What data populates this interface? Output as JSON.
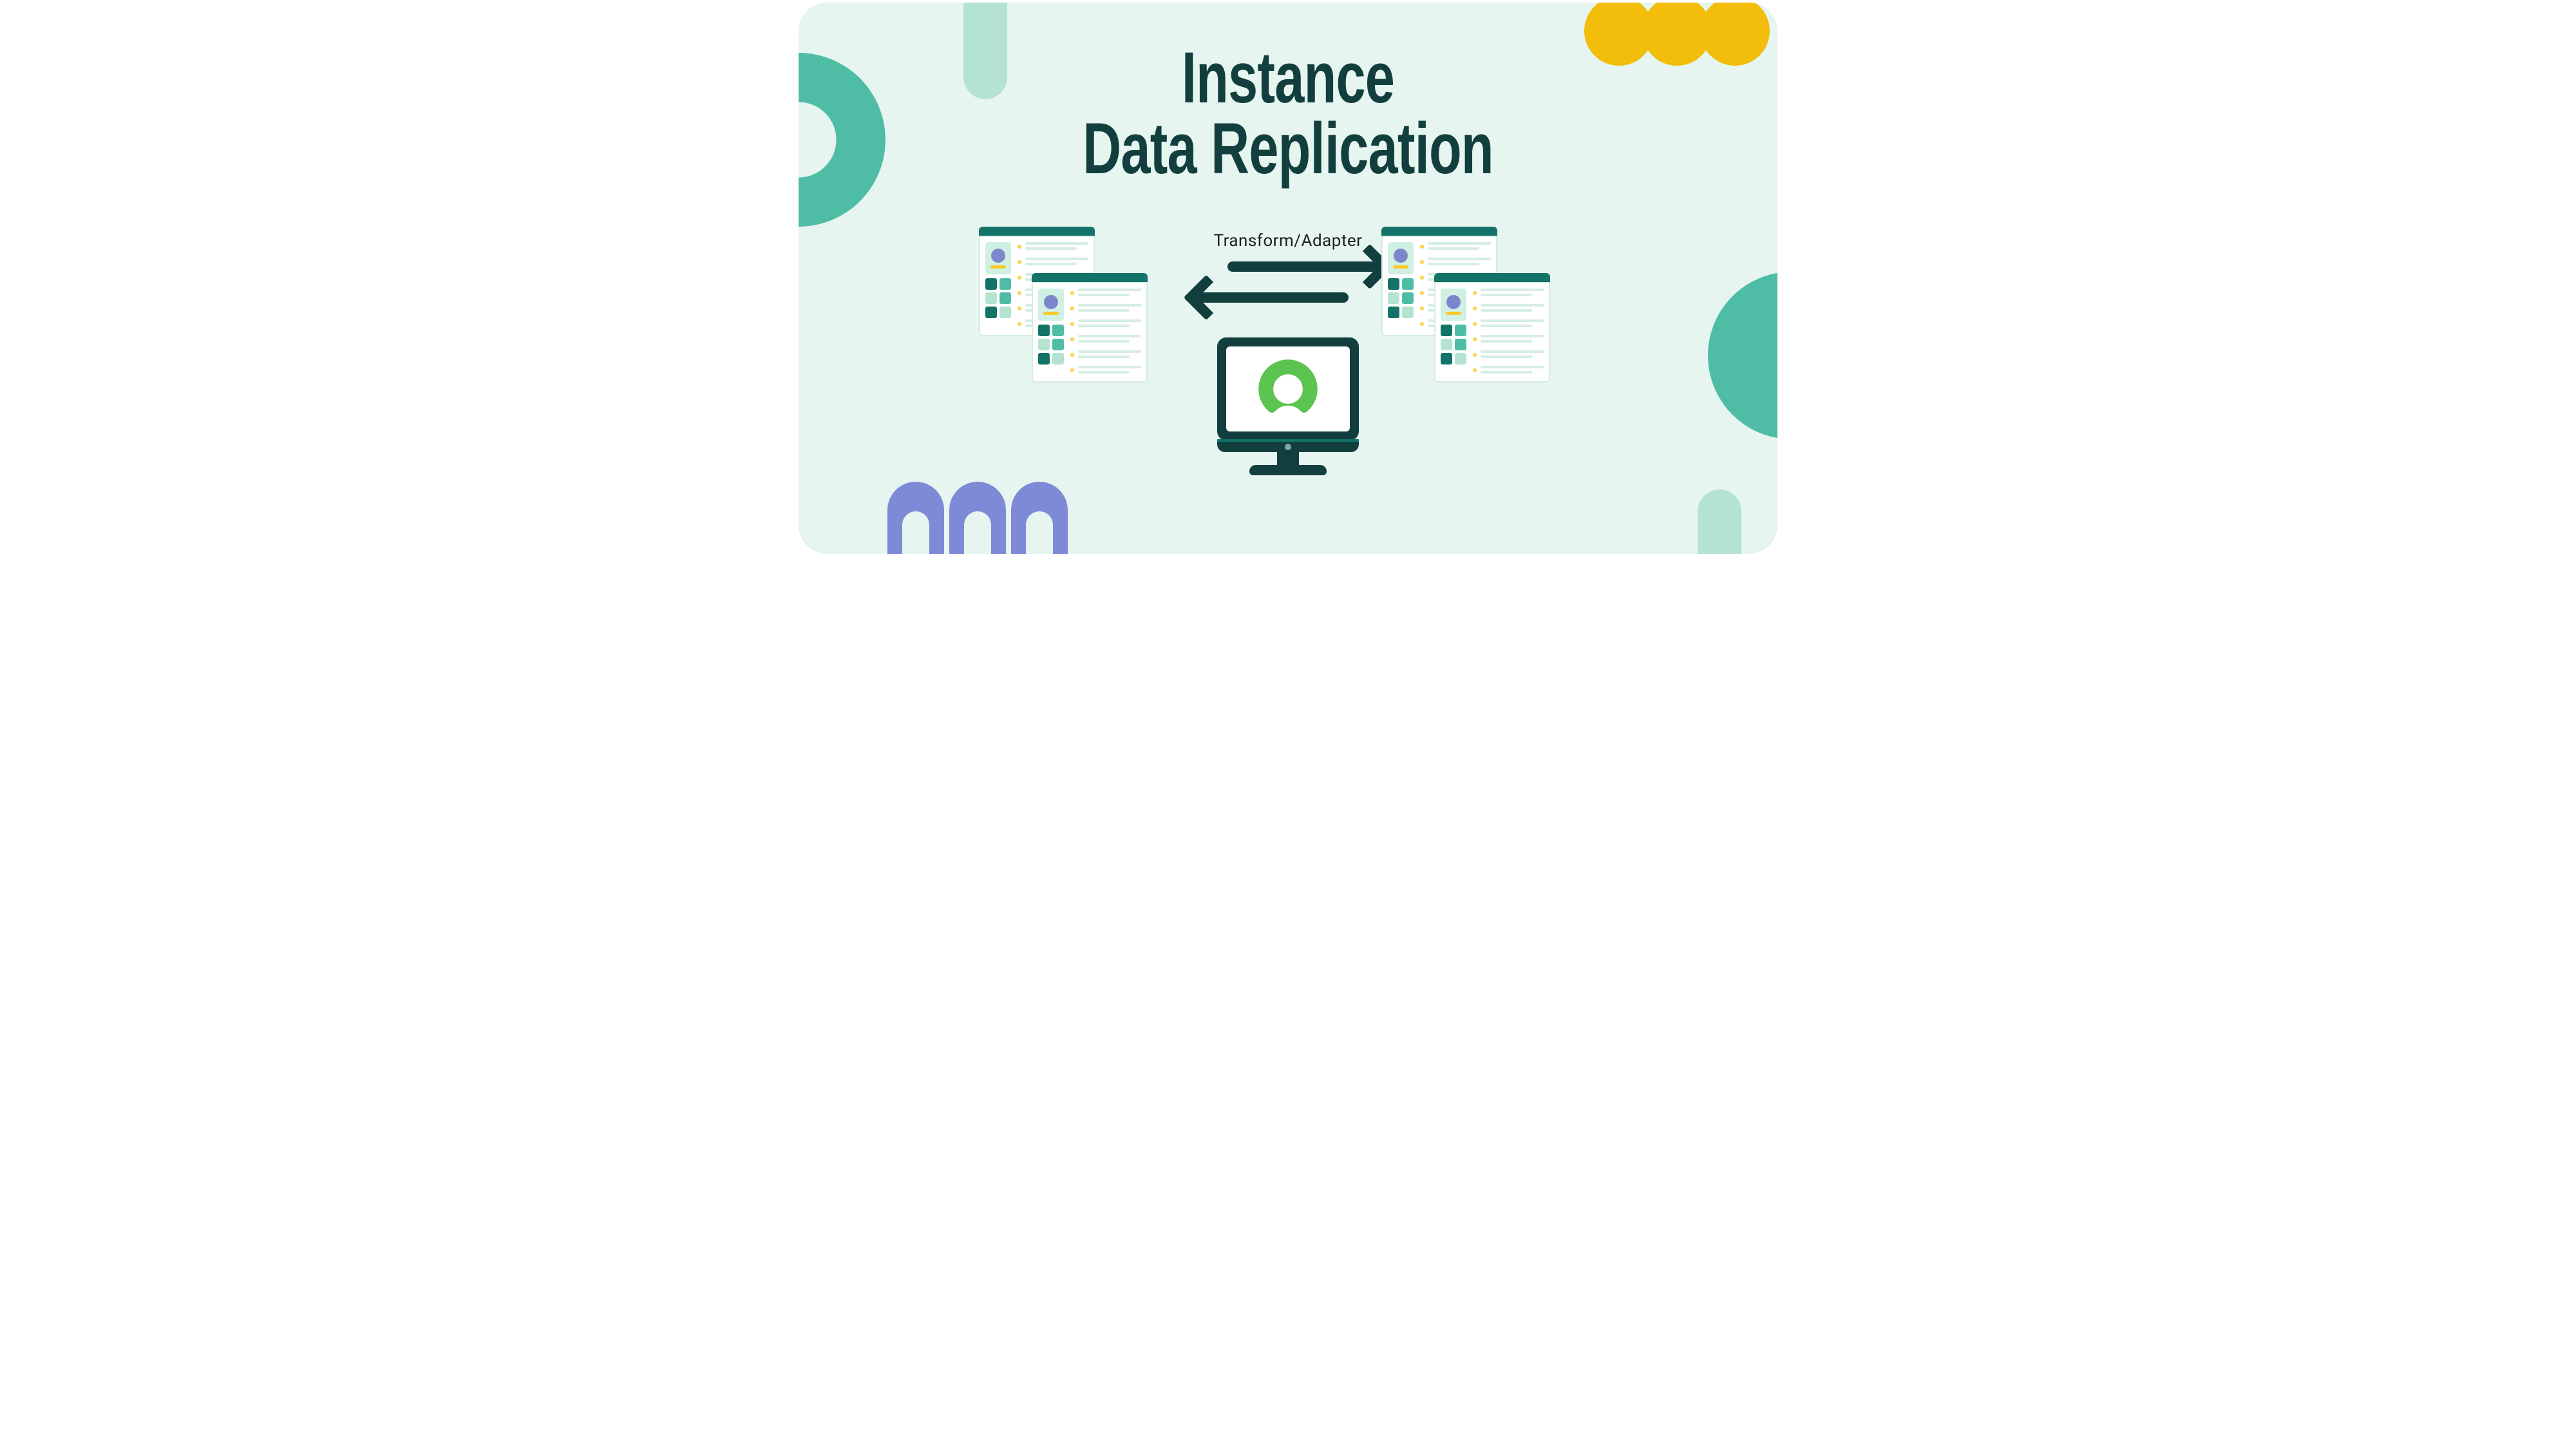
{
  "title": {
    "line1": "Instance",
    "line2": "Data Replication"
  },
  "center_label": "Transform/Adapter",
  "colors": {
    "background": "#e6f5ef",
    "teal_dark": "#123f3e",
    "teal": "#4fbda6",
    "mint": "#b4e3d1",
    "gold": "#f2bd0b",
    "periwinkle": "#7f8ad6",
    "leaf": "#5bc34f"
  },
  "icons": {
    "monitor_logo": "servicenow-logo",
    "arrow_right": "arrow-right",
    "arrow_left": "arrow-left",
    "profile_cards": "profile-list-card"
  }
}
